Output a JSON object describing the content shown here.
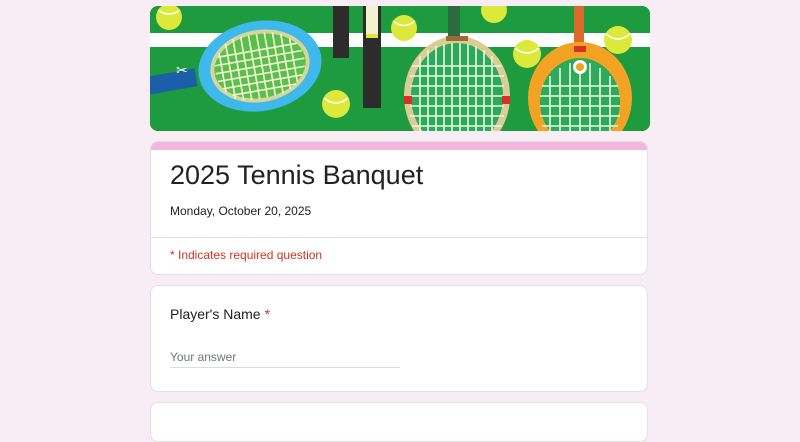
{
  "form": {
    "title": "2025 Tennis Banquet",
    "description": "Monday, October 20, 2025",
    "required_note": "* Indicates required question"
  },
  "questions": [
    {
      "label": "Player's Name",
      "required_marker": "*",
      "answer_value": "",
      "placeholder": "Your answer"
    }
  ],
  "colors": {
    "page_background": "#f8ecf5",
    "accent": "#f2b7dc",
    "required": "#d93025",
    "banner_court": "#1e9a3f",
    "ball": "#dde93a"
  }
}
